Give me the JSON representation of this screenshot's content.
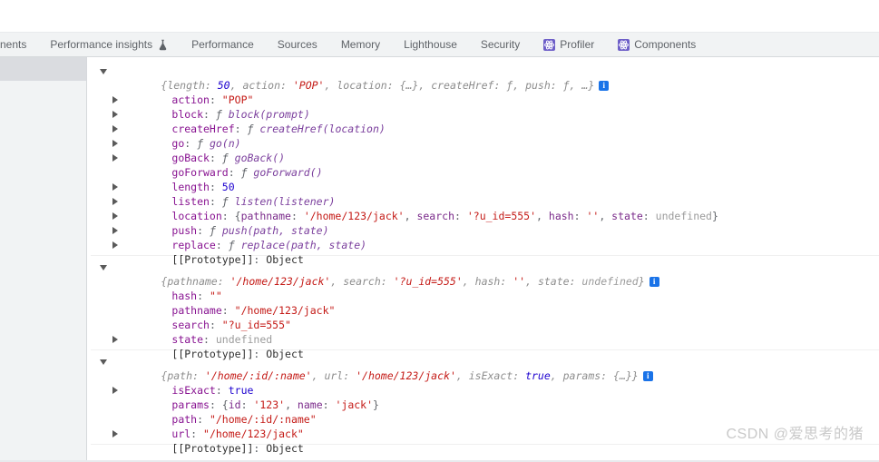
{
  "tabbar": {
    "tabs": [
      {
        "label": "nents",
        "icon": null,
        "active": false
      },
      {
        "label": "Performance insights",
        "icon": "flask-icon",
        "active": false
      },
      {
        "label": "Performance",
        "icon": null,
        "active": false
      },
      {
        "label": "Sources",
        "icon": null,
        "active": false
      },
      {
        "label": "Memory",
        "icon": null,
        "active": false
      },
      {
        "label": "Lighthouse",
        "icon": null,
        "active": false
      },
      {
        "label": "Security",
        "icon": null,
        "active": false
      },
      {
        "label": "Profiler",
        "icon": "react-icon",
        "active": false
      },
      {
        "label": "Components",
        "icon": "react-icon",
        "active": false
      }
    ]
  },
  "colors": {
    "tabbar_bg": "#f1f3f4",
    "sidebar_bg": "#f1f3f4",
    "sidebar_selected": "#dadce0",
    "property_name": "#881391",
    "string_value": "#c41a16",
    "number_value": "#1c00cf",
    "undefined_value": "#9b9b9b",
    "preview_text": "#8d8d8d",
    "react_icon_purple": "#6e5fc8",
    "info_badge_blue": "#1a73e8",
    "watermark": "#c9c9c9"
  },
  "console": {
    "groups": [
      {
        "name": "history-object",
        "header": {
          "preview": "{length: 50, action: 'POP', location: {…}, createHref: ƒ, push: ƒ, …}",
          "badge": "i"
        },
        "rows": [
          {
            "expandable": false,
            "key": "action",
            "value": "\"POP\"",
            "value_type": "string"
          },
          {
            "expandable": true,
            "key": "block",
            "value": "ƒ block(prompt)",
            "value_type": "function"
          },
          {
            "expandable": true,
            "key": "createHref",
            "value": "ƒ createHref(location)",
            "value_type": "function"
          },
          {
            "expandable": true,
            "key": "go",
            "value": "ƒ go(n)",
            "value_type": "function"
          },
          {
            "expandable": true,
            "key": "goBack",
            "value": "ƒ goBack()",
            "value_type": "function"
          },
          {
            "expandable": true,
            "key": "goForward",
            "value": "ƒ goForward()",
            "value_type": "function"
          },
          {
            "expandable": false,
            "key": "length",
            "value": "50",
            "value_type": "number"
          },
          {
            "expandable": true,
            "key": "listen",
            "value": "ƒ listen(listener)",
            "value_type": "function"
          },
          {
            "expandable": true,
            "key": "location",
            "value": "{pathname: '/home/123/jack', search: '?u_id=555', hash: '', state: undefined}",
            "value_type": "object-preview"
          },
          {
            "expandable": true,
            "key": "push",
            "value": "ƒ push(path, state)",
            "value_type": "function"
          },
          {
            "expandable": true,
            "key": "replace",
            "value": "ƒ replace(path, state)",
            "value_type": "function"
          },
          {
            "expandable": true,
            "key": "[[Prototype]]",
            "value": "Object",
            "value_type": "proto"
          }
        ]
      },
      {
        "name": "location-object",
        "header": {
          "preview": "{pathname: '/home/123/jack', search: '?u_id=555', hash: '', state: undefined}",
          "badge": "i"
        },
        "rows": [
          {
            "expandable": false,
            "key": "hash",
            "value": "\"\"",
            "value_type": "string"
          },
          {
            "expandable": false,
            "key": "pathname",
            "value": "\"/home/123/jack\"",
            "value_type": "string"
          },
          {
            "expandable": false,
            "key": "search",
            "value": "\"?u_id=555\"",
            "value_type": "string"
          },
          {
            "expandable": false,
            "key": "state",
            "value": "undefined",
            "value_type": "undefined"
          },
          {
            "expandable": true,
            "key": "[[Prototype]]",
            "value": "Object",
            "value_type": "proto"
          }
        ]
      },
      {
        "name": "match-object",
        "header": {
          "preview": "{path: '/home/:id/:name', url: '/home/123/jack', isExact: true, params: {…}}",
          "badge": "i"
        },
        "rows": [
          {
            "expandable": false,
            "key": "isExact",
            "value": "true",
            "value_type": "boolean"
          },
          {
            "expandable": true,
            "key": "params",
            "value": "{id: '123', name: 'jack'}",
            "value_type": "object-preview"
          },
          {
            "expandable": false,
            "key": "path",
            "value": "\"/home/:id/:name\"",
            "value_type": "string"
          },
          {
            "expandable": false,
            "key": "url",
            "value": "\"/home/123/jack\"",
            "value_type": "string"
          },
          {
            "expandable": true,
            "key": "[[Prototype]]",
            "value": "Object",
            "value_type": "proto"
          }
        ]
      }
    ]
  },
  "watermark": {
    "text": "CSDN @爱思考的猪"
  }
}
